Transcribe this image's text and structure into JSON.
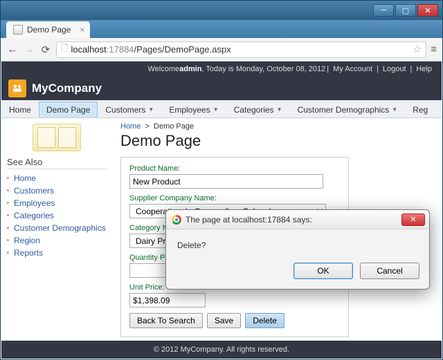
{
  "window": {
    "title": "Demo Page"
  },
  "browser": {
    "tab_title": "Demo Page",
    "url_host": "localhost",
    "url_port": ":17884",
    "url_path": "/Pages/DemoPage.aspx"
  },
  "welcome": {
    "prefix": "Welcome ",
    "user": "admin",
    "date_text": ", Today is Monday, October 08, 2012 ",
    "my_account": "My Account",
    "logout": "Logout",
    "help": "Help"
  },
  "brand": "MyCompany",
  "menu": {
    "items": [
      {
        "label": "Home",
        "dropdown": false
      },
      {
        "label": "Demo Page",
        "dropdown": false,
        "active": true
      },
      {
        "label": "Customers",
        "dropdown": true
      },
      {
        "label": "Employees",
        "dropdown": true
      },
      {
        "label": "Categories",
        "dropdown": true
      },
      {
        "label": "Customer Demographics",
        "dropdown": true
      },
      {
        "label": "Reg",
        "dropdown": false
      }
    ]
  },
  "sidebar": {
    "heading": "See Also",
    "items": [
      "Home",
      "Customers",
      "Employees",
      "Categories",
      "Customer Demographics",
      "Region",
      "Reports"
    ]
  },
  "breadcrumb": {
    "root": "Home",
    "sep": ">",
    "current": "Demo Page"
  },
  "page_title": "Demo Page",
  "form": {
    "product_name": {
      "label": "Product Name:",
      "value": "New Product"
    },
    "supplier": {
      "label": "Supplier Company Name:",
      "value": "Cooperativa de Quesos 'Las Cabras'"
    },
    "category": {
      "label": "Category Name:",
      "value": "Dairy Products"
    },
    "qty": {
      "label": "Quantity Per Unit:",
      "value": ""
    },
    "price": {
      "label": "Unit Price:",
      "value": "$1,398.09"
    },
    "buttons": {
      "back": "Back To Search",
      "save": "Save",
      "delete": "Delete"
    }
  },
  "footer": "© 2012 MyCompany. All rights reserved.",
  "alert": {
    "title": "The page at localhost:17884 says:",
    "message": "Delete?",
    "ok": "OK",
    "cancel": "Cancel"
  }
}
